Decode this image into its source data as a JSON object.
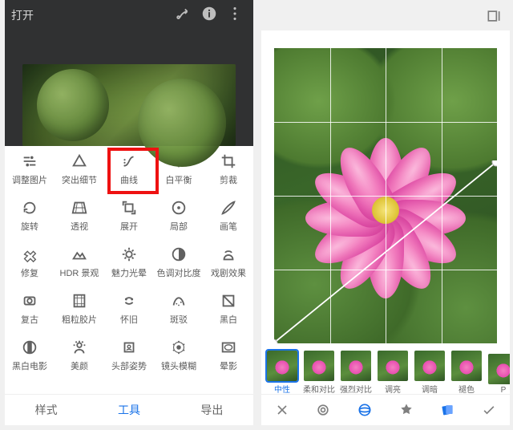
{
  "left": {
    "topbar": {
      "open": "打开"
    },
    "bottom": {
      "styles": "样式",
      "tools": "工具",
      "export": "导出"
    },
    "highlighted_tool": "曲线",
    "tools": [
      {
        "name": "调整图片",
        "icon": "tune"
      },
      {
        "name": "突出细节",
        "icon": "details"
      },
      {
        "name": "曲线",
        "icon": "curves"
      },
      {
        "name": "白平衡",
        "icon": "wb"
      },
      {
        "name": "剪裁",
        "icon": "crop"
      },
      {
        "name": "旋转",
        "icon": "rotate"
      },
      {
        "name": "透视",
        "icon": "perspective"
      },
      {
        "name": "展开",
        "icon": "expand"
      },
      {
        "name": "局部",
        "icon": "selective"
      },
      {
        "name": "画笔",
        "icon": "brush"
      },
      {
        "name": "修复",
        "icon": "heal"
      },
      {
        "name": "HDR 景观",
        "icon": "hdr"
      },
      {
        "name": "魅力光晕",
        "icon": "glow"
      },
      {
        "name": "色调对比度",
        "icon": "tonal"
      },
      {
        "name": "戏剧效果",
        "icon": "drama"
      },
      {
        "name": "复古",
        "icon": "vintage"
      },
      {
        "name": "粗粒胶片",
        "icon": "film"
      },
      {
        "name": "怀旧",
        "icon": "retro"
      },
      {
        "name": "斑驳",
        "icon": "grunge"
      },
      {
        "name": "黑白",
        "icon": "bw"
      },
      {
        "name": "黑白电影",
        "icon": "noir"
      },
      {
        "name": "美颜",
        "icon": "portrait"
      },
      {
        "name": "头部姿势",
        "icon": "headpose"
      },
      {
        "name": "镜头模糊",
        "icon": "lensblur"
      },
      {
        "name": "晕影",
        "icon": "vignette"
      }
    ]
  },
  "right": {
    "selected_preset": "中性",
    "presets": [
      {
        "name": "中性"
      },
      {
        "name": "柔和对比"
      },
      {
        "name": "强烈对比"
      },
      {
        "name": "调亮"
      },
      {
        "name": "调暗"
      },
      {
        "name": "褪色"
      },
      {
        "name": "P"
      }
    ]
  }
}
